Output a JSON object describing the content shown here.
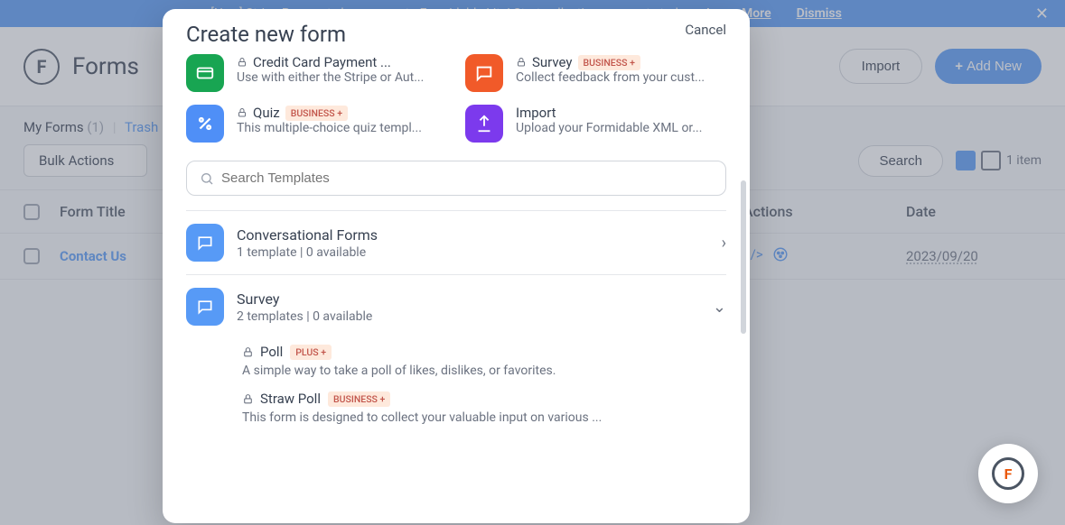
{
  "banner": {
    "text": "[New] Stripe Payments have come to Formidable Lite! Start collecting payments today.",
    "learn": "Learn More",
    "dismiss": "Dismiss"
  },
  "header": {
    "title": "Forms",
    "import": "Import",
    "add_new": "Add New"
  },
  "subnav": {
    "my_forms": "My Forms",
    "count": "(1)",
    "trash": "Trash"
  },
  "toolbar": {
    "bulk": "Bulk Actions",
    "search": "Search",
    "item_count": "1 item"
  },
  "table": {
    "col_title": "Form Title",
    "col_actions": "Actions",
    "col_date": "Date",
    "rows": [
      {
        "title": "Contact Us",
        "date": "2023/09/20"
      }
    ]
  },
  "modal": {
    "title": "Create new form",
    "cancel": "Cancel",
    "quick": [
      {
        "title_prefix": "Credit Card Payment ...",
        "desc": "Use with either the Stripe or Aut...",
        "color": "#18a552",
        "icon": "card",
        "locked": true,
        "badge": ""
      },
      {
        "title_prefix": "Survey",
        "desc": "Collect feedback from your cust...",
        "color": "#f15a29",
        "icon": "chat",
        "locked": true,
        "badge": "BUSINESS +"
      },
      {
        "title_prefix": "Quiz",
        "desc": "This multiple-choice quiz templ...",
        "color": "#4f8ff7",
        "icon": "percent",
        "locked": true,
        "badge": "BUSINESS +"
      },
      {
        "title_prefix": "Import",
        "desc": "Upload your Formidable XML or...",
        "color": "#7c3aed",
        "icon": "upload",
        "locked": false,
        "badge": ""
      }
    ],
    "search_placeholder": "Search Templates",
    "categories": [
      {
        "title": "Conversational Forms",
        "sub": "1 template  |  0 available",
        "expanded": false
      },
      {
        "title": "Survey",
        "sub": "2 templates  |  0 available",
        "expanded": true
      }
    ],
    "survey_sub": [
      {
        "title": "Poll",
        "badge": "PLUS +",
        "desc": "A simple way to take a poll of likes, dislikes, or favorites."
      },
      {
        "title": "Straw Poll",
        "badge": "BUSINESS +",
        "desc": "This form is designed to collect your valuable input on various ..."
      }
    ]
  }
}
